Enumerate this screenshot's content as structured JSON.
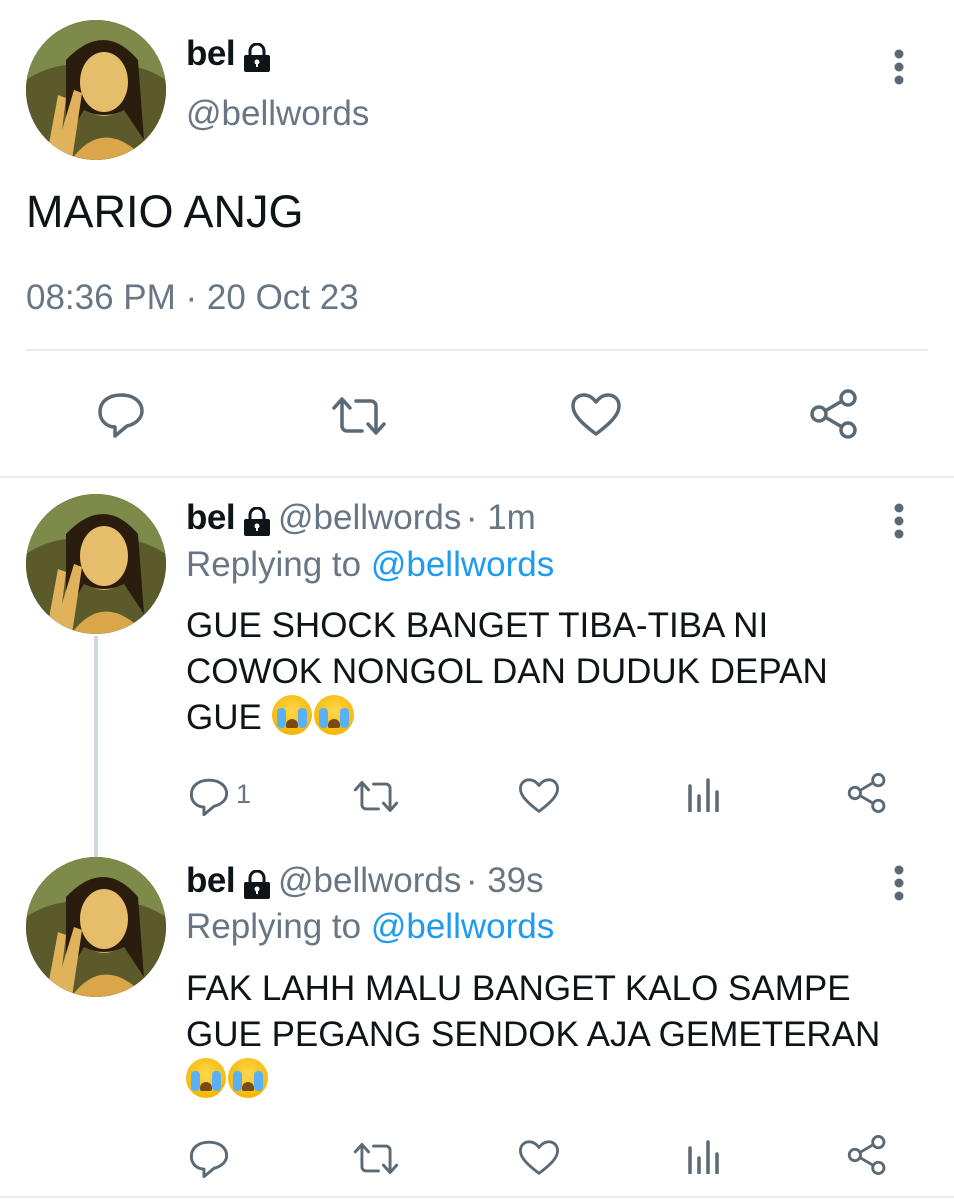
{
  "main_tweet": {
    "display_name": "bel",
    "handle": "@bellwords",
    "text": "MARIO ANJG",
    "timestamp": "08:36 PM · 20 Oct 23",
    "actions": [
      "reply-icon",
      "retweet-icon",
      "like-icon",
      "share-icon"
    ]
  },
  "replies": [
    {
      "display_name": "bel",
      "handle": "@bellwords",
      "age": "· 1m",
      "replying_prefix": "Replying to",
      "replying_to": "@bellwords",
      "lines": [
        "GUE SHOCK BANGET TIBA-TIBA NI",
        "COWOK NONGOL DAN DUDUK DEPAN",
        "GUE"
      ],
      "emoji": "loudly-crying-face x2",
      "reply_count": "1"
    },
    {
      "display_name": "bel",
      "handle": "@bellwords",
      "age": "· 39s",
      "replying_prefix": "Replying to",
      "replying_to": "@bellwords",
      "lines": [
        "FAK LAHH MALU BANGET KALO SAMPE",
        "GUE PEGANG SENDOK AJA GEMETERAN"
      ],
      "emoji": "loudly-crying-face x2",
      "reply_count": ""
    }
  ],
  "colors": {
    "text": "#0f1419",
    "muted": "#687684",
    "link": "#1d9bf0",
    "divider": "#e6ecf0",
    "thread_line": "#cfd9de"
  }
}
